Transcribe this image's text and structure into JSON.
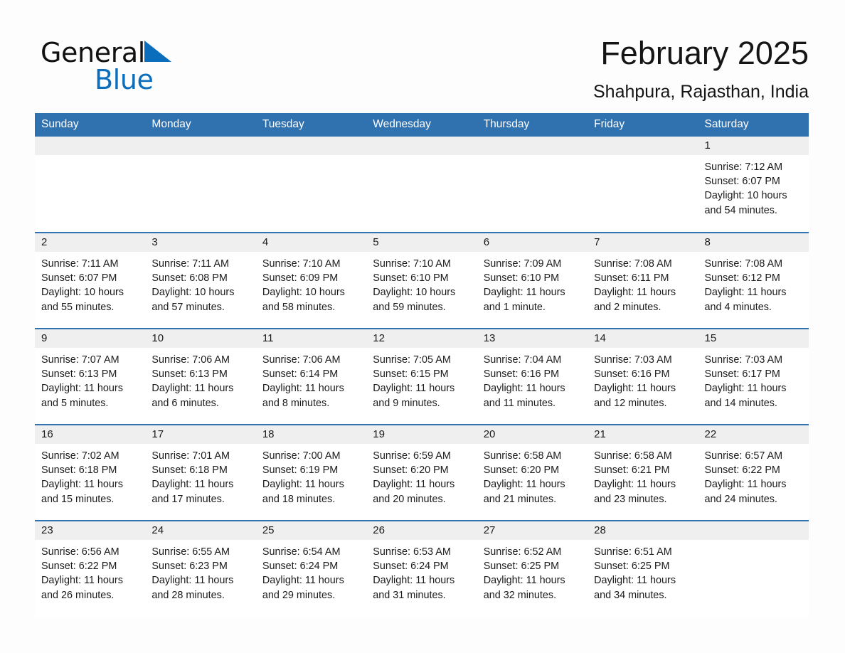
{
  "brand": {
    "name_part1": "General",
    "name_part2": "Blue",
    "flag_icon": "triangle-flag-icon",
    "accent_color": "#0a6ebd"
  },
  "header": {
    "month_title": "February 2025",
    "location": "Shahpura, Rajasthan, India"
  },
  "theme": {
    "header_blue": "#3071b0",
    "daynum_band": "#efefef",
    "page_background": "#fdfdfd"
  },
  "calendar": {
    "weekday_headers": [
      "Sunday",
      "Monday",
      "Tuesday",
      "Wednesday",
      "Thursday",
      "Friday",
      "Saturday"
    ],
    "labels": {
      "sunrise": "Sunrise:",
      "sunset": "Sunset:",
      "daylight": "Daylight:"
    },
    "weeks": [
      [
        {
          "day": "",
          "blank": true
        },
        {
          "day": "",
          "blank": true
        },
        {
          "day": "",
          "blank": true
        },
        {
          "day": "",
          "blank": true
        },
        {
          "day": "",
          "blank": true
        },
        {
          "day": "",
          "blank": true
        },
        {
          "day": "1",
          "sunrise": "Sunrise: 7:12 AM",
          "sunset": "Sunset: 6:07 PM",
          "daylight": "Daylight: 10 hours and 54 minutes."
        }
      ],
      [
        {
          "day": "2",
          "sunrise": "Sunrise: 7:11 AM",
          "sunset": "Sunset: 6:07 PM",
          "daylight": "Daylight: 10 hours and 55 minutes."
        },
        {
          "day": "3",
          "sunrise": "Sunrise: 7:11 AM",
          "sunset": "Sunset: 6:08 PM",
          "daylight": "Daylight: 10 hours and 57 minutes."
        },
        {
          "day": "4",
          "sunrise": "Sunrise: 7:10 AM",
          "sunset": "Sunset: 6:09 PM",
          "daylight": "Daylight: 10 hours and 58 minutes."
        },
        {
          "day": "5",
          "sunrise": "Sunrise: 7:10 AM",
          "sunset": "Sunset: 6:10 PM",
          "daylight": "Daylight: 10 hours and 59 minutes."
        },
        {
          "day": "6",
          "sunrise": "Sunrise: 7:09 AM",
          "sunset": "Sunset: 6:10 PM",
          "daylight": "Daylight: 11 hours and 1 minute."
        },
        {
          "day": "7",
          "sunrise": "Sunrise: 7:08 AM",
          "sunset": "Sunset: 6:11 PM",
          "daylight": "Daylight: 11 hours and 2 minutes."
        },
        {
          "day": "8",
          "sunrise": "Sunrise: 7:08 AM",
          "sunset": "Sunset: 6:12 PM",
          "daylight": "Daylight: 11 hours and 4 minutes."
        }
      ],
      [
        {
          "day": "9",
          "sunrise": "Sunrise: 7:07 AM",
          "sunset": "Sunset: 6:13 PM",
          "daylight": "Daylight: 11 hours and 5 minutes."
        },
        {
          "day": "10",
          "sunrise": "Sunrise: 7:06 AM",
          "sunset": "Sunset: 6:13 PM",
          "daylight": "Daylight: 11 hours and 6 minutes."
        },
        {
          "day": "11",
          "sunrise": "Sunrise: 7:06 AM",
          "sunset": "Sunset: 6:14 PM",
          "daylight": "Daylight: 11 hours and 8 minutes."
        },
        {
          "day": "12",
          "sunrise": "Sunrise: 7:05 AM",
          "sunset": "Sunset: 6:15 PM",
          "daylight": "Daylight: 11 hours and 9 minutes."
        },
        {
          "day": "13",
          "sunrise": "Sunrise: 7:04 AM",
          "sunset": "Sunset: 6:16 PM",
          "daylight": "Daylight: 11 hours and 11 minutes."
        },
        {
          "day": "14",
          "sunrise": "Sunrise: 7:03 AM",
          "sunset": "Sunset: 6:16 PM",
          "daylight": "Daylight: 11 hours and 12 minutes."
        },
        {
          "day": "15",
          "sunrise": "Sunrise: 7:03 AM",
          "sunset": "Sunset: 6:17 PM",
          "daylight": "Daylight: 11 hours and 14 minutes."
        }
      ],
      [
        {
          "day": "16",
          "sunrise": "Sunrise: 7:02 AM",
          "sunset": "Sunset: 6:18 PM",
          "daylight": "Daylight: 11 hours and 15 minutes."
        },
        {
          "day": "17",
          "sunrise": "Sunrise: 7:01 AM",
          "sunset": "Sunset: 6:18 PM",
          "daylight": "Daylight: 11 hours and 17 minutes."
        },
        {
          "day": "18",
          "sunrise": "Sunrise: 7:00 AM",
          "sunset": "Sunset: 6:19 PM",
          "daylight": "Daylight: 11 hours and 18 minutes."
        },
        {
          "day": "19",
          "sunrise": "Sunrise: 6:59 AM",
          "sunset": "Sunset: 6:20 PM",
          "daylight": "Daylight: 11 hours and 20 minutes."
        },
        {
          "day": "20",
          "sunrise": "Sunrise: 6:58 AM",
          "sunset": "Sunset: 6:20 PM",
          "daylight": "Daylight: 11 hours and 21 minutes."
        },
        {
          "day": "21",
          "sunrise": "Sunrise: 6:58 AM",
          "sunset": "Sunset: 6:21 PM",
          "daylight": "Daylight: 11 hours and 23 minutes."
        },
        {
          "day": "22",
          "sunrise": "Sunrise: 6:57 AM",
          "sunset": "Sunset: 6:22 PM",
          "daylight": "Daylight: 11 hours and 24 minutes."
        }
      ],
      [
        {
          "day": "23",
          "sunrise": "Sunrise: 6:56 AM",
          "sunset": "Sunset: 6:22 PM",
          "daylight": "Daylight: 11 hours and 26 minutes."
        },
        {
          "day": "24",
          "sunrise": "Sunrise: 6:55 AM",
          "sunset": "Sunset: 6:23 PM",
          "daylight": "Daylight: 11 hours and 28 minutes."
        },
        {
          "day": "25",
          "sunrise": "Sunrise: 6:54 AM",
          "sunset": "Sunset: 6:24 PM",
          "daylight": "Daylight: 11 hours and 29 minutes."
        },
        {
          "day": "26",
          "sunrise": "Sunrise: 6:53 AM",
          "sunset": "Sunset: 6:24 PM",
          "daylight": "Daylight: 11 hours and 31 minutes."
        },
        {
          "day": "27",
          "sunrise": "Sunrise: 6:52 AM",
          "sunset": "Sunset: 6:25 PM",
          "daylight": "Daylight: 11 hours and 32 minutes."
        },
        {
          "day": "28",
          "sunrise": "Sunrise: 6:51 AM",
          "sunset": "Sunset: 6:25 PM",
          "daylight": "Daylight: 11 hours and 34 minutes."
        },
        {
          "day": "",
          "blank": true
        }
      ]
    ]
  }
}
